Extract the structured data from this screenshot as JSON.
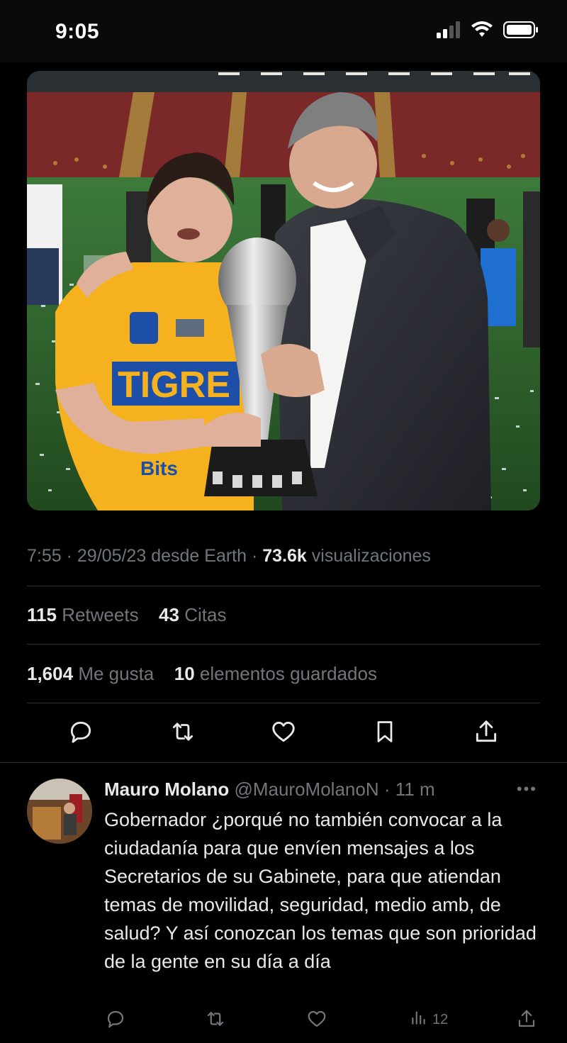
{
  "status_bar": {
    "time": "9:05"
  },
  "tweet": {
    "time": "7:55",
    "date": "29/05/23",
    "source_prefix": "desde",
    "source": "Earth",
    "views_count": "73.6k",
    "views_label": "visualizaciones",
    "retweets_count": "115",
    "retweets_label": "Retweets",
    "quotes_count": "43",
    "quotes_label": "Citas",
    "likes_count": "1,604",
    "likes_label": "Me gusta",
    "bookmarks_count": "10",
    "bookmarks_label": "elementos guardados",
    "jersey_text": "TIGRE",
    "sponsor_text": "Bits"
  },
  "reply": {
    "name": "Mauro Molano",
    "handle": "@MauroMolanoN",
    "separator": "·",
    "age": "11 m",
    "text": "Gobernador ¿porqué no también convocar a la ciudadanía para que envíen mensajes a los Secretarios de su Gabinete, para que atiendan temas de movilidad, seguridad, medio amb, de salud?  Y así conozcan los temas que son prioridad de la gente en su día a día",
    "views": "12"
  },
  "colors": {
    "background": "#000000",
    "text_primary": "#e7e9ea",
    "text_secondary": "#71767b",
    "divider": "#2f3336",
    "jersey_yellow": "#f5b21e",
    "jersey_blue": "#1e4fa8"
  },
  "icons": {
    "action_bar": [
      "reply-icon",
      "retweet-icon",
      "like-icon",
      "bookmark-icon",
      "share-icon"
    ],
    "reply_bar": [
      "reply-icon",
      "retweet-icon",
      "like-icon",
      "views-icon",
      "share-icon"
    ],
    "status": [
      "signal-icon",
      "wifi-icon",
      "battery-icon"
    ]
  }
}
